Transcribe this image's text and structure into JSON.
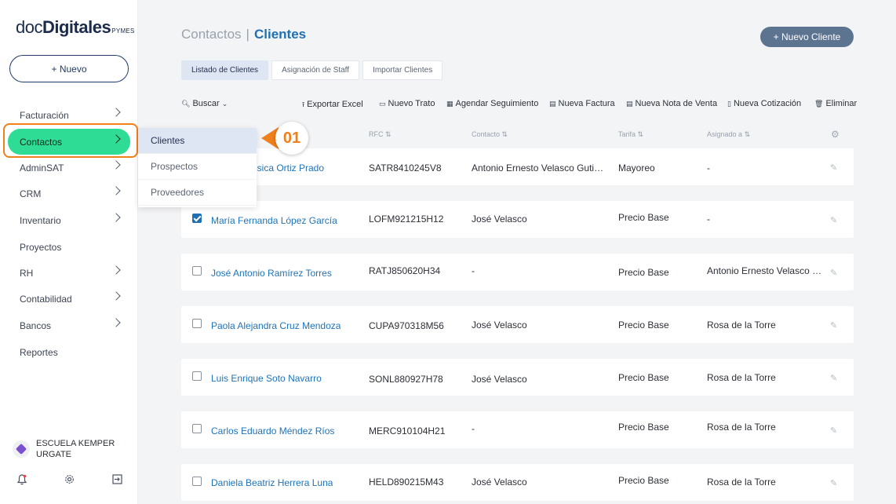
{
  "app": {
    "logo": {
      "part1": "doc",
      "part2": "Digitales",
      "part3": "PYMES"
    },
    "new_button": "+ Nuevo"
  },
  "sidebar": {
    "items": [
      {
        "label": "Facturación",
        "has_chevron": true
      },
      {
        "label": "Contactos",
        "has_chevron": true,
        "active": true
      },
      {
        "label": "AdminSAT",
        "has_chevron": true
      },
      {
        "label": "CRM",
        "has_chevron": true
      },
      {
        "label": "Inventario",
        "has_chevron": true
      },
      {
        "label": "Proyectos",
        "has_chevron": false
      },
      {
        "label": "RH",
        "has_chevron": true
      },
      {
        "label": "Contabilidad",
        "has_chevron": true
      },
      {
        "label": "Bancos",
        "has_chevron": true
      },
      {
        "label": "Reportes",
        "has_chevron": false
      }
    ],
    "company_name": "ESCUELA KEMPER URGATE",
    "bottom_icons": [
      "notification-icon",
      "settings-icon",
      "logout-icon"
    ]
  },
  "submenu": {
    "items": [
      "Clientes",
      "Prospectos",
      "Proveedores"
    ],
    "selected": "Clientes"
  },
  "callout": {
    "label": "01",
    "color": "#f0801c"
  },
  "header": {
    "breadcrumb_parent": "Contactos",
    "separator": "|",
    "breadcrumb_current": "Clientes",
    "new_client_button": "+ Nuevo Cliente"
  },
  "tabs": [
    "Listado de Clientes",
    "Asignación de Staff",
    "Importar Clientes"
  ],
  "toolbar": {
    "search": "Buscar",
    "actions": [
      "Exportar Excel",
      "Nuevo Trato",
      "Agendar Seguimiento",
      "Nueva Factura",
      "Nueva Nota de Venta",
      "Nueva Cotización",
      "Eliminar"
    ]
  },
  "table": {
    "columns": [
      "RFC",
      "Contacto",
      "Tarifa",
      "Asignado a"
    ],
    "rows": [
      {
        "name": "Jéssica Ortiz Prado",
        "name_visible": "essica Ortiz Prado",
        "rfc": "SATR8410245V8",
        "contacto": "Antonio Ernesto Velasco Gutiér...",
        "tarifa": "Mayoreo",
        "asignado": "-",
        "checked": false
      },
      {
        "name": "María Fernanda López García",
        "rfc": "LOFM921215H12",
        "contacto": "José Velasco",
        "tarifa": "Precio Base",
        "asignado": "-",
        "checked": true
      },
      {
        "name": "José Antonio Ramírez Torres",
        "rfc": "RATJ850620H34",
        "contacto": "-",
        "tarifa": "Precio Base",
        "asignado": "Antonio Ernesto Velasco G...",
        "checked": false
      },
      {
        "name": "Paola Alejandra Cruz Mendoza",
        "rfc": "CUPA970318M56",
        "contacto": "José Velasco",
        "tarifa": "Precio Base",
        "asignado": "Rosa de la Torre",
        "checked": false
      },
      {
        "name": "Luis Enrique Soto Navarro",
        "rfc": "SONL880927H78",
        "contacto": "José Velasco",
        "tarifa": "Precio Base",
        "asignado": "Rosa de la Torre",
        "checked": false
      },
      {
        "name": "Carlos Eduardo Méndez Ríos",
        "rfc": "MERC910104H21",
        "contacto": "-",
        "tarifa": "Precio Base",
        "asignado": "Rosa de la Torre",
        "checked": false
      },
      {
        "name": "Daniela Beatriz Herrera Luna",
        "rfc": "HELD890215M43",
        "contacto": "José Velasco",
        "tarifa": "Precio Base",
        "asignado": "Rosa de la Torre",
        "checked": false
      }
    ]
  },
  "colors": {
    "accent_green": "#2fdc95",
    "brand_blue": "#1f6fb2",
    "highlight_orange": "#f0801c",
    "button_slate": "#5d7490"
  }
}
